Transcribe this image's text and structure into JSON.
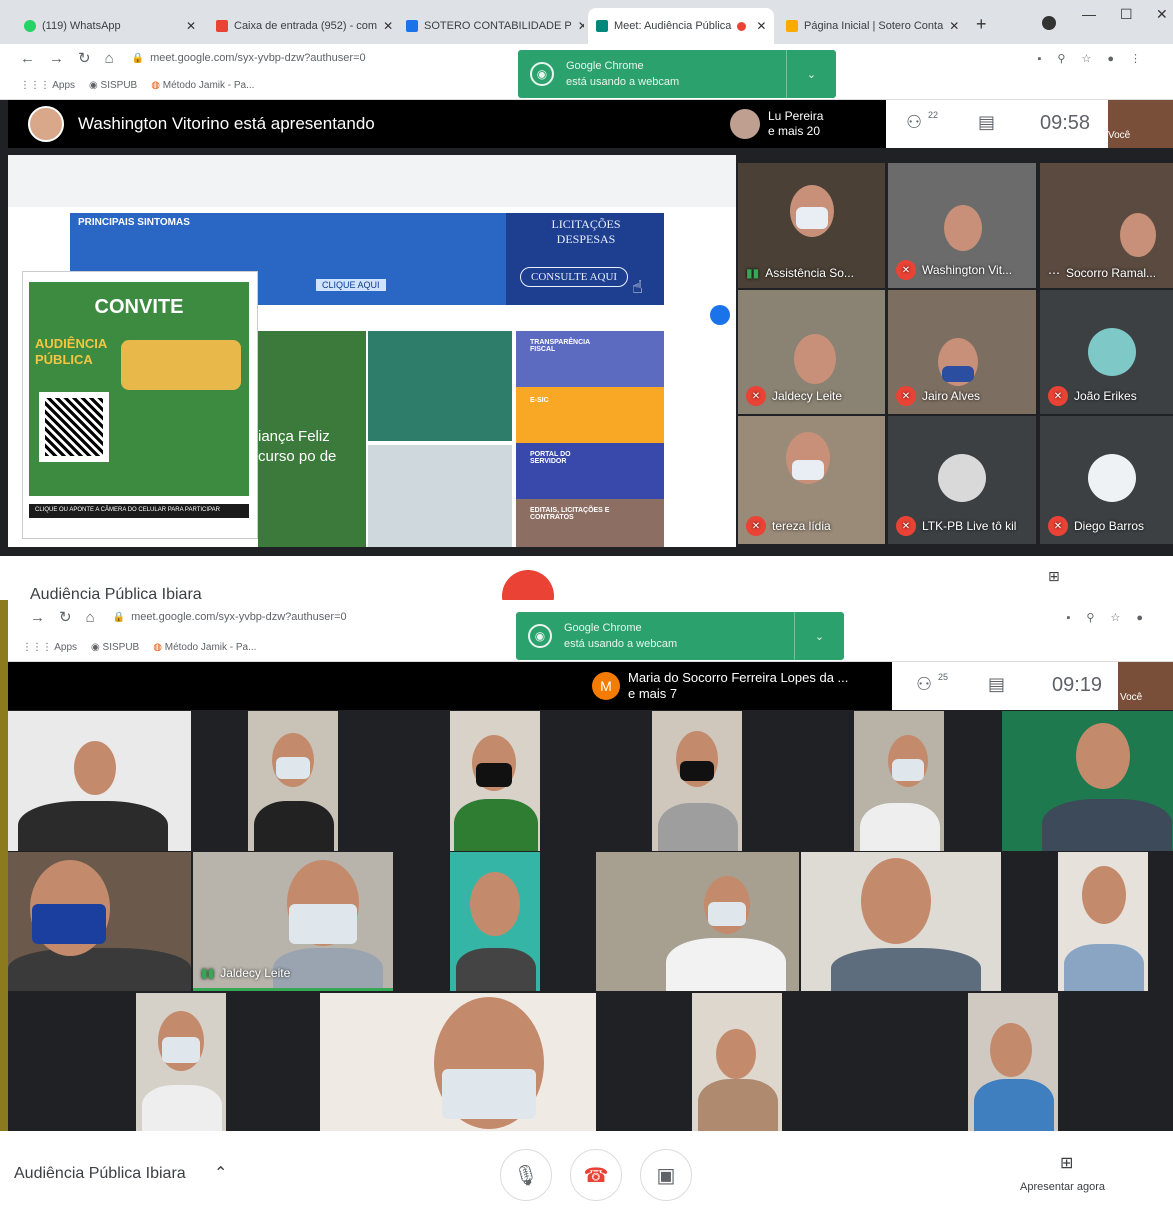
{
  "top_window": {
    "tabs": [
      {
        "label": "(119) WhatsApp",
        "color": "#25d366"
      },
      {
        "label": "Caixa de entrada (952) - com",
        "color": "#ea4335"
      },
      {
        "label": "SOTERO CONTABILIDADE P",
        "color": "#1a73e8"
      },
      {
        "label": "Meet: Audiência Pública",
        "color": "#00897b"
      },
      {
        "label": "Página Inicial | Sotero Conta",
        "color": "#f9ab00"
      }
    ],
    "new_tab": "+",
    "url": "meet.google.com/syx-yvbp-dzw?authuser=0",
    "bookmarks": {
      "apps": "Apps",
      "sispub": "SISPUB",
      "metodo": "Método Jamik - Pa..."
    },
    "chrome_popup": {
      "line1": "Google Chrome",
      "line2": "está usando a webcam"
    },
    "presenter_text": "Washington Vitorino está apresentando",
    "others": {
      "line1": "Lu Pereira",
      "line2": "e mais 20"
    },
    "participants_count": "22",
    "time": "09:58",
    "self_label": "Você",
    "tiles": [
      {
        "name": "Assistência So..."
      },
      {
        "name": "Washington Vit..."
      },
      {
        "name": "Socorro Ramal..."
      },
      {
        "name": "Jaldecy Leite"
      },
      {
        "name": "Jairo Alves"
      },
      {
        "name": "João Erikes"
      },
      {
        "name": "tereza lídia"
      },
      {
        "name": "LTK-PB Live tô kil"
      },
      {
        "name": "Diego Barros"
      }
    ],
    "shared_screen": {
      "banner_left": "PRINCIPAIS SINTOMAS",
      "banner_right_title": "LICITAÇÕES DESPESAS",
      "banner_button": "CONSULTE AQUI",
      "banner_click": "CLIQUE AQUI",
      "convite_title": "CONVITE",
      "convite_sub": "AUDIÊNCIA PÚBLICA",
      "convite_footer": "CLIQUE OU APONTE A CÂMERA DO CELULAR PARA PARTICIPAR",
      "behind_text": "iança Feliz curso po de",
      "cards": [
        {
          "title": "TRANSPARÊNCIA FISCAL",
          "color": "#5c6bc0"
        },
        {
          "title": "E-SIC",
          "color": "#f9a825"
        },
        {
          "title": "PORTAL DO SERVIDOR",
          "color": "#3949ab"
        },
        {
          "title": "EDITAIS, LICITAÇÕES E CONTRATOS",
          "color": "#8d6e63"
        }
      ]
    },
    "meeting_title_partial": "Audiência Pública Ibiara"
  },
  "bottom_window": {
    "url": "meet.google.com/syx-yvbp-dzw?authuser=0",
    "bookmarks": {
      "apps": "Apps",
      "sispub": "SISPUB",
      "metodo": "Método Jamik - Pa..."
    },
    "chrome_popup": {
      "line1": "Google Chrome",
      "line2": "está usando a webcam"
    },
    "others_initial": "M",
    "others": {
      "line1": "Maria do Socorro Ferreira Lopes da ...",
      "line2": "e mais 7"
    },
    "participants_count": "25",
    "time": "09:19",
    "self_label": "Você",
    "tile_label": "Jaldecy Leite",
    "meeting_title": "Audiência Pública Ibiara",
    "present_now": "Apresentar agora"
  },
  "colors": {
    "meet_green": "#2ba26d",
    "hangup_red": "#ea4335",
    "frame_gold": "#8c7a1e"
  }
}
